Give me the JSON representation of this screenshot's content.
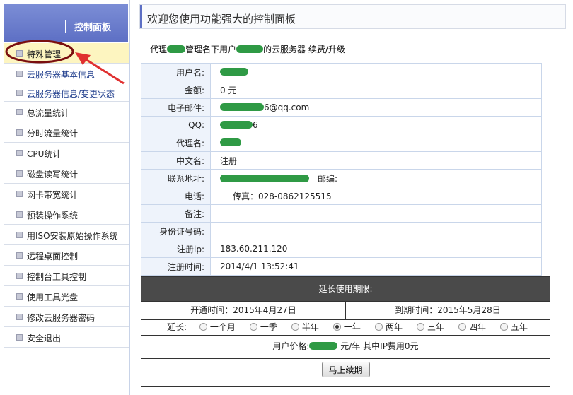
{
  "sidebar": {
    "title": "控制面板",
    "items": [
      {
        "label": "特殊管理",
        "kind": "active"
      },
      {
        "label": "云服务器基本信息",
        "kind": "sub"
      },
      {
        "label": "云服务器信息/变更状态",
        "kind": "sub"
      },
      {
        "label": "总流量统计",
        "kind": ""
      },
      {
        "label": "分时流量统计",
        "kind": ""
      },
      {
        "label": "CPU统计",
        "kind": ""
      },
      {
        "label": "磁盘读写统计",
        "kind": ""
      },
      {
        "label": "网卡带宽统计",
        "kind": ""
      },
      {
        "label": "预装操作系统",
        "kind": ""
      },
      {
        "label": "用ISO安装原始操作系统",
        "kind": ""
      },
      {
        "label": "远程桌面控制",
        "kind": ""
      },
      {
        "label": "控制台工具控制",
        "kind": ""
      },
      {
        "label": "使用工具光盘",
        "kind": ""
      },
      {
        "label": "修改云服务器密码",
        "kind": ""
      },
      {
        "label": "安全退出",
        "kind": ""
      }
    ]
  },
  "header": {
    "title": "欢迎您使用功能强大的控制面板"
  },
  "info_line": {
    "prefix": "代理",
    "mid": "管理名下用户",
    "suffix": "的云服务器 续费/升级"
  },
  "account": {
    "rows": [
      {
        "label": "用户名:",
        "value": ""
      },
      {
        "label": "金额:",
        "value": "0 元"
      },
      {
        "label": "电子邮件:",
        "value": "6@qq.com"
      },
      {
        "label": "QQ:",
        "value": "6"
      },
      {
        "label": "代理名:",
        "value": ""
      },
      {
        "label": "中文名:",
        "value": "注册"
      },
      {
        "label": "联系地址:",
        "value": ""
      },
      {
        "label": "电话:",
        "value": ""
      },
      {
        "label": "备注:",
        "value": ""
      },
      {
        "label": "身份证号码:",
        "value": ""
      },
      {
        "label": "注册ip:",
        "value": "183.60.211.120"
      },
      {
        "label": "注册时间:",
        "value": "2014/4/1 13:52:41"
      }
    ],
    "postcode_label": "邮编:",
    "fax_text": "传真：028-0862125515"
  },
  "extend": {
    "header": "延长使用期限:",
    "open_time": "开通时间：2015年4月27日",
    "expire_time": "到期时间：2015年5月28日",
    "extend_label": "延长:",
    "options": [
      "一个月",
      "一季",
      "半年",
      "一年",
      "两年",
      "三年",
      "四年",
      "五年"
    ],
    "selected": "一年",
    "price_prefix": "用户价格:",
    "price_suffix": "元/年 其中IP费用0元",
    "renew_button": "马上续期"
  },
  "colors": {
    "sidebar_header": "#6a7dcc",
    "active_item": "#fdf5c0",
    "table_label_bg": "#eef3fb",
    "panel_header": "#4a4a4a",
    "redaction": "#2f9a45",
    "annotation": "#e03030"
  }
}
